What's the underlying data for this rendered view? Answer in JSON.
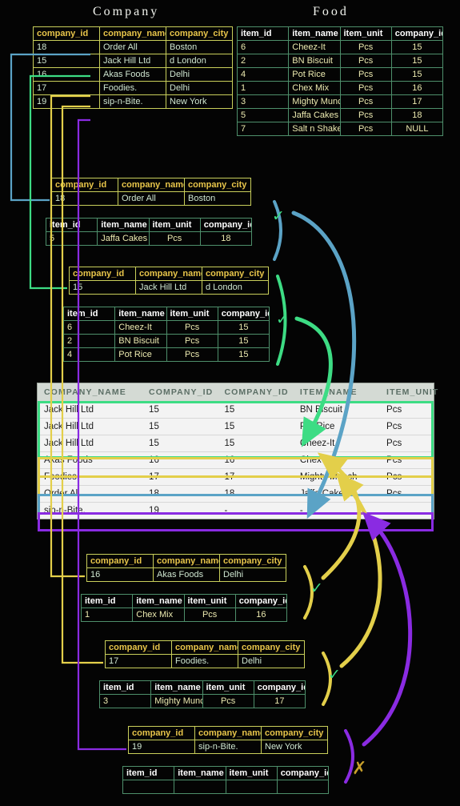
{
  "titles": {
    "company": "Company",
    "food": "Food"
  },
  "company_table": {
    "columns": [
      "company_id",
      "company_name",
      "company_city"
    ],
    "rows": [
      [
        "18",
        "Order All",
        "Boston"
      ],
      [
        "15",
        "Jack Hill Ltd",
        "d London"
      ],
      [
        "16",
        "Akas Foods",
        "Delhi"
      ],
      [
        "17",
        "Foodies.",
        "Delhi"
      ],
      [
        "19",
        "sip-n-Bite.",
        "New York"
      ]
    ]
  },
  "food_table": {
    "columns": [
      "item_id",
      "item_name",
      "item_unit",
      "company_id"
    ],
    "rows": [
      [
        "6",
        "Cheez-It",
        "Pcs",
        "15"
      ],
      [
        "2",
        "BN Biscuit",
        "Pcs",
        "15"
      ],
      [
        "4",
        "Pot Rice",
        "Pcs",
        "15"
      ],
      [
        "1",
        "Chex Mix",
        "Pcs",
        "16"
      ],
      [
        "3",
        "Mighty Munch",
        "Pcs",
        "17"
      ],
      [
        "5",
        "Jaffa Cakes",
        "Pcs",
        "18"
      ],
      [
        "7",
        "Salt n Shake",
        "Pcs",
        "NULL"
      ]
    ]
  },
  "groups": [
    {
      "key": "order-all",
      "color": "#5ba3c6",
      "match": "check",
      "company": {
        "columns": [
          "company_id",
          "company_name",
          "company_city"
        ],
        "rows": [
          [
            "18",
            "Order All",
            "Boston"
          ]
        ]
      },
      "food": {
        "columns": [
          "item_id",
          "item_name",
          "item_unit",
          "company_id"
        ],
        "rows": [
          [
            "5",
            "Jaffa Cakes",
            "Pcs",
            "18"
          ]
        ]
      }
    },
    {
      "key": "jack-hill",
      "color": "#3ddc84",
      "match": "check",
      "company": {
        "columns": [
          "company_id",
          "company_name",
          "company_city"
        ],
        "rows": [
          [
            "15",
            "Jack Hill Ltd",
            "d London"
          ]
        ]
      },
      "food": {
        "columns": [
          "item_id",
          "item_name",
          "item_unit",
          "company_id"
        ],
        "rows": [
          [
            "6",
            "Cheez-It",
            "Pcs",
            "15"
          ],
          [
            "2",
            "BN Biscuit",
            "Pcs",
            "15"
          ],
          [
            "4",
            "Pot Rice",
            "Pcs",
            "15"
          ]
        ]
      }
    },
    {
      "key": "akas-foods",
      "color": "#e3cf4a",
      "match": "check",
      "company": {
        "columns": [
          "company_id",
          "company_name",
          "company_city"
        ],
        "rows": [
          [
            "16",
            "Akas Foods",
            "Delhi"
          ]
        ]
      },
      "food": {
        "columns": [
          "item_id",
          "item_name",
          "item_unit",
          "company_id"
        ],
        "rows": [
          [
            "1",
            "Chex Mix",
            "Pcs",
            "16"
          ]
        ]
      }
    },
    {
      "key": "foodies",
      "color": "#e3cf4a",
      "match": "check",
      "company": {
        "columns": [
          "company_id",
          "company_name",
          "company_city"
        ],
        "rows": [
          [
            "17",
            "Foodies.",
            "Delhi"
          ]
        ]
      },
      "food": {
        "columns": [
          "item_id",
          "item_name",
          "item_unit",
          "company_id"
        ],
        "rows": [
          [
            "3",
            "Mighty Munch",
            "Pcs",
            "17"
          ]
        ]
      }
    },
    {
      "key": "sip-n-bite",
      "color": "#8a2be2",
      "match": "cross",
      "company": {
        "columns": [
          "company_id",
          "company_name",
          "company_city"
        ],
        "rows": [
          [
            "19",
            "sip-n-Bite.",
            "New York"
          ]
        ]
      },
      "food": {
        "columns": [
          "item_id",
          "item_name",
          "item_unit",
          "company_id"
        ],
        "rows": [
          [
            "",
            "",
            "",
            ""
          ]
        ]
      }
    }
  ],
  "result_table": {
    "columns": [
      "COMPANY_NAME",
      "COMPANY_ID",
      "COMPANY_ID",
      "ITEM_NAME",
      "ITEM_UNIT"
    ],
    "rows": [
      [
        "Jack Hill Ltd",
        "15",
        "15",
        "BN Biscuit",
        "Pcs"
      ],
      [
        "Jack Hill Ltd",
        "15",
        "15",
        "Pot Rice",
        "Pcs"
      ],
      [
        "Jack Hill Ltd",
        "15",
        "15",
        "Cheez-It",
        "Pcs"
      ],
      [
        "Akas Foods",
        "16",
        "16",
        "Chex Mix",
        "Pcs"
      ],
      [
        "Foodies.",
        "17",
        "17",
        "Mighty Munch",
        "Pcs"
      ],
      [
        "Order All",
        "18",
        "18",
        "Jaffa Cakes",
        "Pcs"
      ],
      [
        "sip-n-Bite.",
        "19",
        "-",
        "-",
        ""
      ]
    ]
  },
  "marks": {
    "check": "✓",
    "cross": "✗"
  },
  "colors": {
    "blue": "#5ba3c6",
    "green": "#3ddc84",
    "yellow": "#e3cf4a",
    "purple": "#8a2be2",
    "check_green": "#3ddc84",
    "cross_gold": "#c8a02a",
    "company_border": "#c9cf5b",
    "food_border": "#4e8f6b"
  }
}
